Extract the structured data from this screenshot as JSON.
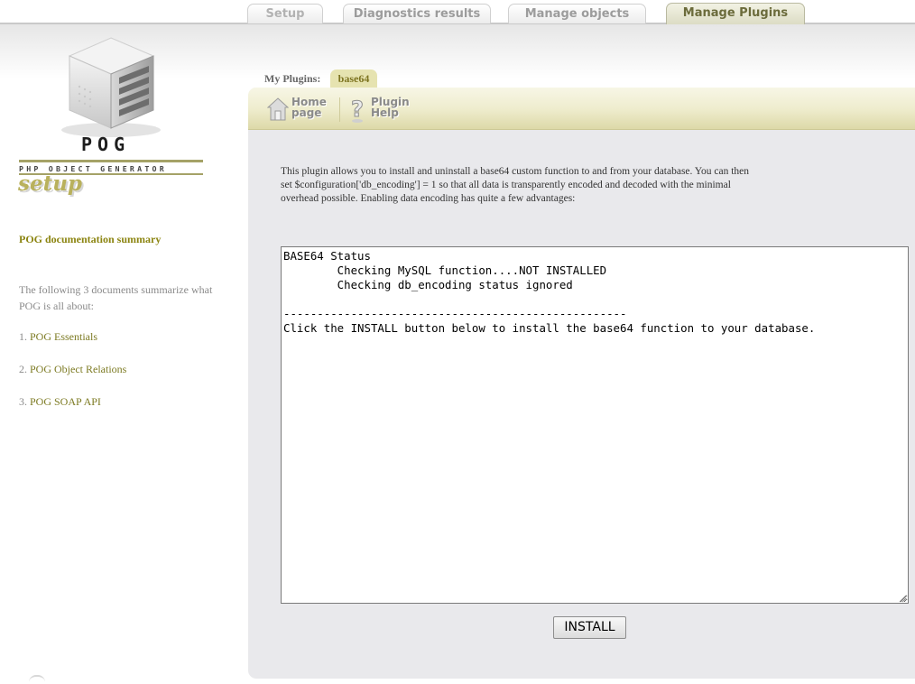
{
  "tabs": [
    {
      "label": "Setup",
      "active": false
    },
    {
      "label": "Diagnostics results",
      "active": false
    },
    {
      "label": "Manage objects",
      "active": false
    },
    {
      "label": "Manage Plugins",
      "active": true
    }
  ],
  "sidebar": {
    "logo_text": "POG",
    "logo_subtitle": "PHP OBJECT GENERATOR",
    "logo_tag": "setup",
    "doc_title": "POG documentation summary",
    "doc_intro": "The following 3 documents summarize what POG is all about:",
    "links": [
      {
        "num": "1.",
        "label": "POG Essentials"
      },
      {
        "num": "2.",
        "label": "POG Object Relations"
      },
      {
        "num": "3.",
        "label": "POG SOAP API"
      }
    ]
  },
  "main": {
    "my_plugins_label": "My Plugins:",
    "active_plugin": "base64",
    "toolbar": {
      "home_line1": "Home",
      "home_line2": "page",
      "help_line1": "Plugin",
      "help_line2": "Help"
    },
    "description": "This plugin allows you to install and uninstall a base64 custom function to and from your database. You can then set $configuration['db_encoding'] = 1 so that all data is transparently encoded and decoded with the minimal overhead possible. Enabling data encoding has quite a few advantages:",
    "status_text": "BASE64 Status\n        Checking MySQL function....NOT INSTALLED\n        Checking db_encoding status ignored\n\n---------------------------------------------------\nClick the INSTALL button below to install the base64 function to your database.",
    "install_label": "INSTALL"
  },
  "colors": {
    "accent": "#8b8410",
    "tab_active_text": "#6b6b3b",
    "toolbar_bg": "#efedcf",
    "panel_bg": "#e9e9ec"
  },
  "icons": {
    "home": "home-icon",
    "help": "help-icon",
    "logo": "server-cube-icon"
  }
}
